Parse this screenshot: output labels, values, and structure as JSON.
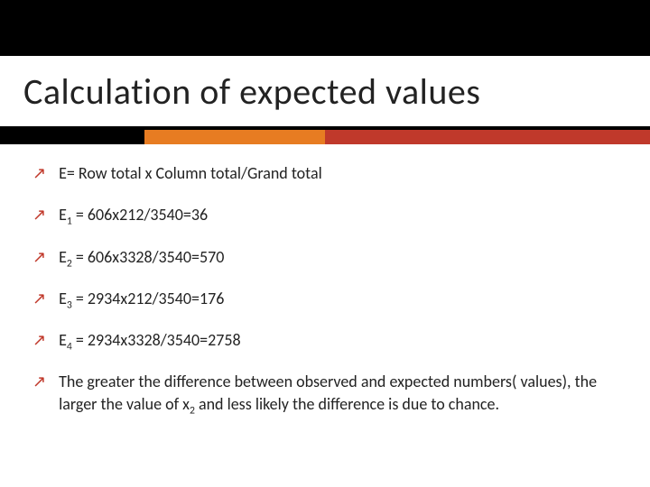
{
  "title": "Calculation of expected values",
  "bullets": {
    "b0": "E= Row total x Column total/Grand total",
    "b1_pre": "E",
    "b1_sub": "1",
    "b1_post": " = 606x212/3540=36",
    "b2_pre": "E",
    "b2_sub": "2",
    "b2_post": " = 606x3328/3540=570",
    "b3_pre": "E",
    "b3_sub": "3",
    "b3_post": " = 2934x212/3540=176",
    "b4_pre": "E",
    "b4_sub": "4",
    "b4_post": " = 2934x3328/3540=2758",
    "b5_pre": "The greater the difference between observed and expected numbers( values), the larger the value of x",
    "b5_sub": "2",
    "b5_post": "  and less likely the difference is due to chance."
  }
}
